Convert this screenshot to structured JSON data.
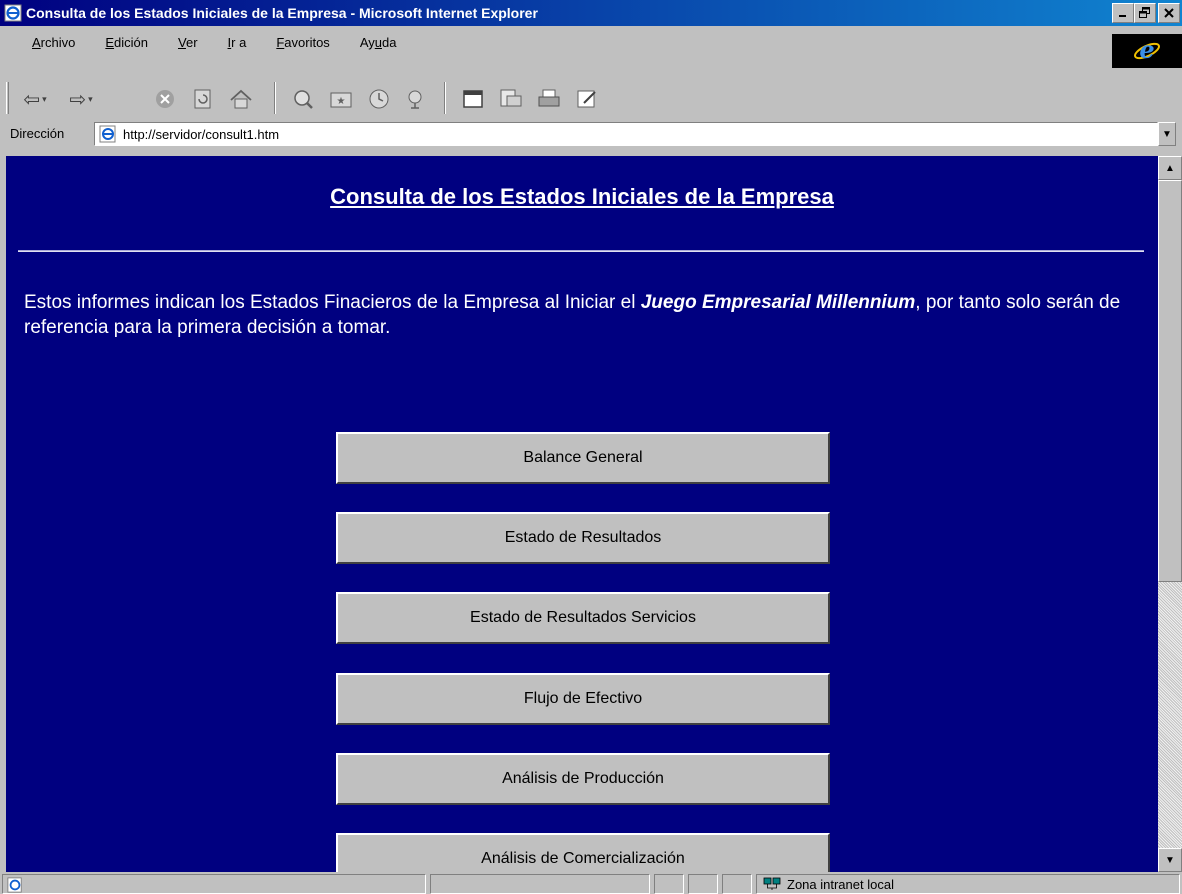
{
  "window": {
    "title": "Consulta de los Estados Iniciales de la Empresa - Microsoft Internet Explorer",
    "icon": "ie-page-icon",
    "controls": [
      "minimize",
      "maximize",
      "close"
    ]
  },
  "menu": {
    "items": [
      {
        "label": "Archivo",
        "u": "A",
        "rest": "rchivo"
      },
      {
        "label": "Edición",
        "u": "E",
        "rest": "dición"
      },
      {
        "label": "Ver",
        "u": "V",
        "rest": "er"
      },
      {
        "label": "Ir a",
        "u": "I",
        "rest": "r a"
      },
      {
        "label": "Favoritos",
        "u": "F",
        "rest": "avoritos"
      },
      {
        "label": "Ayuda",
        "pre": "Ay",
        "u": "u",
        "rest": "da"
      }
    ],
    "logo_icon": "ie-logo-icon"
  },
  "toolbar": {
    "icons": [
      "back-icon",
      "forward-icon",
      "stop-icon",
      "refresh-icon",
      "home-icon",
      "search-icon",
      "favorites-icon",
      "history-icon",
      "channels-icon",
      "fullscreen-icon",
      "mail-icon",
      "print-icon",
      "edit-icon"
    ]
  },
  "address": {
    "label": "Dirección",
    "url": "http://servidor/consult1.htm"
  },
  "page": {
    "title": "Consulta de los Estados Iniciales de la Empresa",
    "intro_part1": "Estos informes indican los Estados Finacieros de la Empresa al Iniciar el ",
    "intro_emphasis": "Juego Empresarial Millennium",
    "intro_part2": ", por tanto solo serán de referencia para la primera decisión a tomar.",
    "buttons": [
      {
        "label": "Balance General"
      },
      {
        "label": "Estado de Resultados"
      },
      {
        "label": "Estado de Resultados Servicios"
      },
      {
        "label": "Flujo de Efectivo"
      },
      {
        "label": "Análisis de Producción"
      },
      {
        "label": "Análisis de Comercialización"
      }
    ],
    "background_color": "#000080",
    "text_color": "#ffffff"
  },
  "status": {
    "zone": "Zona intranet local"
  }
}
